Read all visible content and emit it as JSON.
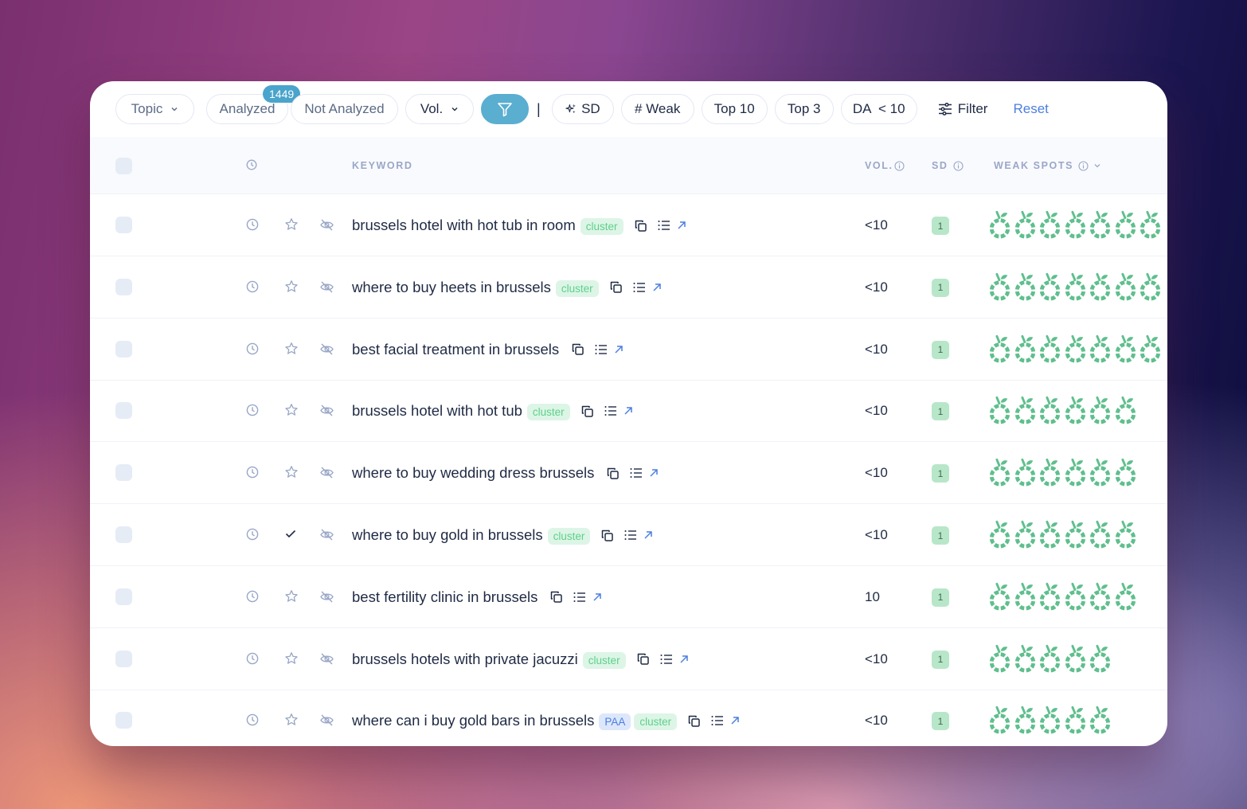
{
  "toolbar": {
    "topic_label": "Topic",
    "analyzed_label": "Analyzed",
    "analyzed_count": "1449",
    "not_analyzed_label": "Not Analyzed",
    "vol_label": "Vol.",
    "separator": "|",
    "sd_label": "SD",
    "weak_label": "# Weak",
    "top10_label": "Top 10",
    "top3_label": "Top 3",
    "da_label": "DA  < 10",
    "filter_label": "Filter",
    "reset_label": "Reset"
  },
  "table": {
    "headers": {
      "keyword": "KEYWORD",
      "vol": "VOL.",
      "sd": "SD",
      "weak_spots": "WEAK SPOTS"
    },
    "rows": [
      {
        "keyword": "brussels hotel with hot tub in room",
        "tags": [
          "cluster"
        ],
        "starred": false,
        "checked_mark": false,
        "vol": "<10",
        "sd": "1",
        "weak_spots": 7
      },
      {
        "keyword": "where to buy heets in brussels",
        "tags": [
          "cluster"
        ],
        "starred": false,
        "checked_mark": false,
        "vol": "<10",
        "sd": "1",
        "weak_spots": 7
      },
      {
        "keyword": "best facial treatment in brussels",
        "tags": [],
        "starred": false,
        "checked_mark": false,
        "vol": "<10",
        "sd": "1",
        "weak_spots": 7
      },
      {
        "keyword": "brussels hotel with hot tub",
        "tags": [
          "cluster"
        ],
        "starred": false,
        "checked_mark": false,
        "vol": "<10",
        "sd": "1",
        "weak_spots": 6
      },
      {
        "keyword": "where to buy wedding dress brussels",
        "tags": [],
        "starred": false,
        "checked_mark": false,
        "vol": "<10",
        "sd": "1",
        "weak_spots": 6
      },
      {
        "keyword": "where to buy gold in brussels",
        "tags": [
          "cluster"
        ],
        "starred": false,
        "checked_mark": true,
        "vol": "<10",
        "sd": "1",
        "weak_spots": 6
      },
      {
        "keyword": "best fertility clinic in brussels",
        "tags": [],
        "starred": false,
        "checked_mark": false,
        "vol": "10",
        "sd": "1",
        "weak_spots": 6
      },
      {
        "keyword": "brussels hotels with private jacuzzi",
        "tags": [
          "cluster"
        ],
        "starred": false,
        "checked_mark": false,
        "vol": "<10",
        "sd": "1",
        "weak_spots": 5
      },
      {
        "keyword": "where can i buy gold bars in brussels",
        "tags": [
          "PAA",
          "cluster"
        ],
        "starred": false,
        "checked_mark": false,
        "vol": "<10",
        "sd": "1",
        "weak_spots": 5
      }
    ]
  },
  "colors": {
    "accent_blue": "#5aaed0",
    "link_blue": "#4c7fe0",
    "weak_spot_green": "#5fbf8d",
    "sd_badge_bg": "#b8e6c9"
  }
}
